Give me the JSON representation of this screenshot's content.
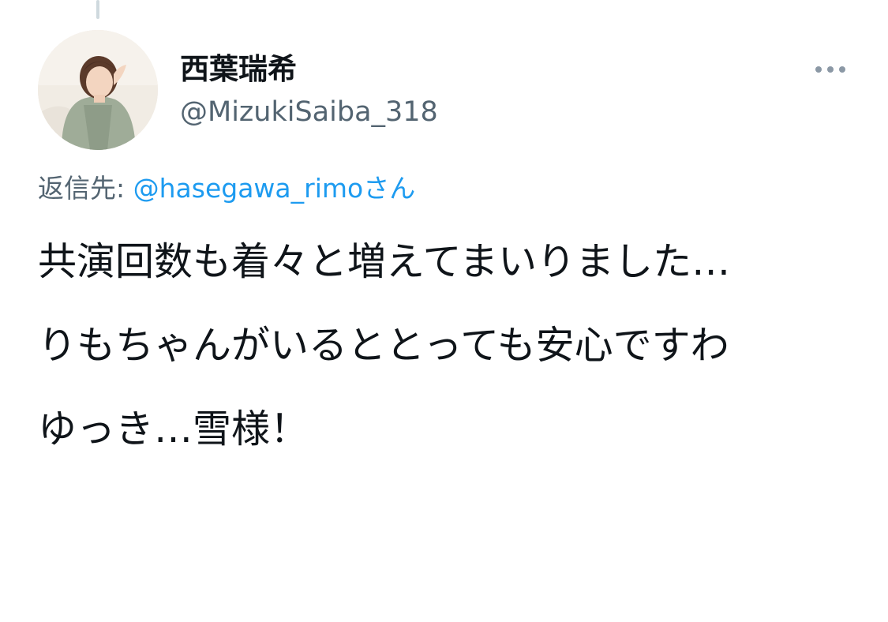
{
  "author": {
    "display_name": "西葉瑞希",
    "handle": "@MizukiSaiba_318"
  },
  "reply": {
    "prefix": "返信先: ",
    "mention": "@hasegawa_rimo",
    "suffix": "さん"
  },
  "body": {
    "paragraphs": [
      "共演回数も着々と増えてまいりました…",
      "りもちゃんがいるととっても安心ですわ",
      "ゆっき…雪様！"
    ]
  },
  "icons": {
    "more": "more-horizontal-icon"
  },
  "colors": {
    "link": "#1d9bf0",
    "secondary_text": "#536471",
    "primary_text": "#0f1419"
  }
}
